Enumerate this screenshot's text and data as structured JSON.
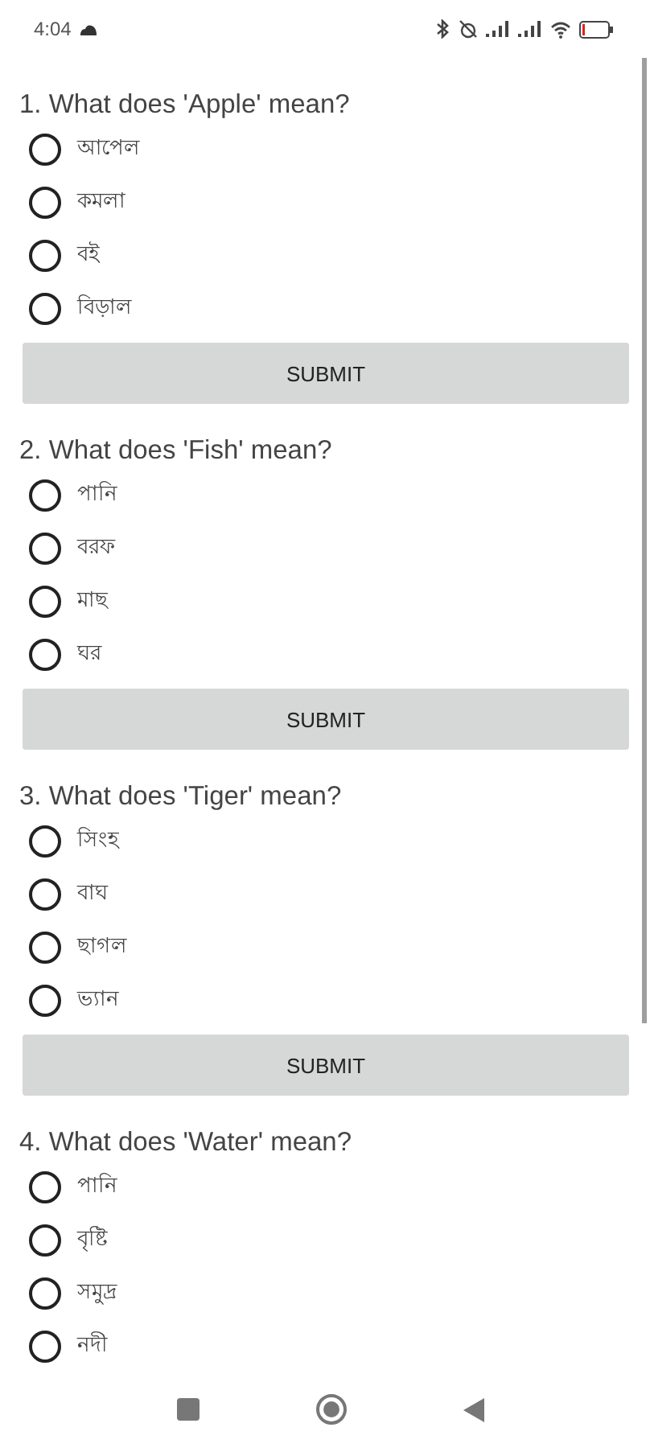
{
  "status_bar": {
    "time": "4:04"
  },
  "questions": [
    {
      "title": "1. What does 'Apple' mean?",
      "options": [
        {
          "label": "আপেল",
          "selected": false
        },
        {
          "label": "কমলা",
          "selected": false
        },
        {
          "label": "বই",
          "selected": false
        },
        {
          "label": "বিড়াল",
          "selected": false
        }
      ],
      "button": "SUBMIT"
    },
    {
      "title": "2. What does 'Fish' mean?",
      "options": [
        {
          "label": "পানি",
          "selected": false
        },
        {
          "label": "বরফ",
          "selected": false
        },
        {
          "label": "মাছ",
          "selected": false
        },
        {
          "label": "ঘর",
          "selected": false
        }
      ],
      "button": "SUBMIT"
    },
    {
      "title": "3. What does 'Tiger' mean?",
      "options": [
        {
          "label": "সিংহ",
          "selected": false
        },
        {
          "label": "বাঘ",
          "selected": false
        },
        {
          "label": "ছাগল",
          "selected": false
        },
        {
          "label": "ভ্যান",
          "selected": false
        }
      ],
      "button": "SUBMIT"
    },
    {
      "title": "4. What does 'Water' mean?",
      "options": [
        {
          "label": "পানি",
          "selected": false
        },
        {
          "label": "বৃষ্টি",
          "selected": false
        },
        {
          "label": "সমুদ্র",
          "selected": false
        },
        {
          "label": "নদী",
          "selected": false
        }
      ]
    }
  ]
}
